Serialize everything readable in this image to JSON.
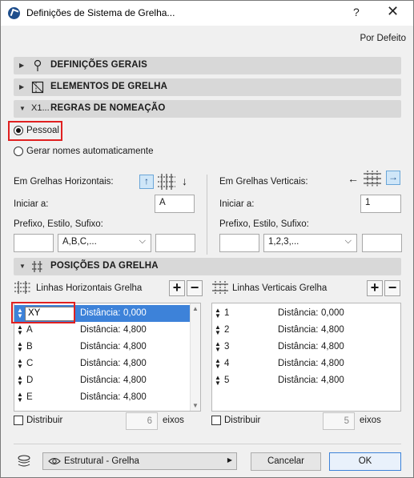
{
  "window": {
    "title": "Definições de Sistema de Grelha...",
    "help": "?",
    "close": "✕"
  },
  "header": {
    "default_link": "Por Defeito"
  },
  "sections": {
    "general": "DEFINIÇÕES GERAIS",
    "elements": "ELEMENTOS DE GRELHA",
    "naming": "REGRAS DE NOMEAÇÃO",
    "naming_icon_text": "X1...",
    "positions": "POSIÇÕES DA GRELHA"
  },
  "naming": {
    "personal": "Pessoal",
    "auto": "Gerar nomes automaticamente",
    "selected": "personal",
    "horizontal": {
      "title": "Em Grelhas Horizontais:",
      "start_label": "Iniciar a:",
      "start_value": "A",
      "prefix_label": "Prefixo, Estilo, Sufixo:",
      "prefix_value": "",
      "style_value": "A,B,C,...",
      "suffix_value": ""
    },
    "vertical": {
      "title": "Em Grelhas Verticais:",
      "start_label": "Iniciar a:",
      "start_value": "1",
      "prefix_label": "Prefixo, Estilo, Sufixo:",
      "prefix_value": "",
      "style_value": "1,2,3,...",
      "suffix_value": ""
    }
  },
  "positions": {
    "horizontal": {
      "title": "Linhas Horizontais Grelha",
      "rows": [
        {
          "name": "XY",
          "dist_label": "Distância:",
          "dist_value": "0,000",
          "selected": true
        },
        {
          "name": "A",
          "dist_label": "Distância:",
          "dist_value": "4,800"
        },
        {
          "name": "B",
          "dist_label": "Distância:",
          "dist_value": "4,800"
        },
        {
          "name": "C",
          "dist_label": "Distância:",
          "dist_value": "4,800"
        },
        {
          "name": "D",
          "dist_label": "Distância:",
          "dist_value": "4,800"
        },
        {
          "name": "E",
          "dist_label": "Distância:",
          "dist_value": "4,800"
        }
      ],
      "distribute_label": "Distribuir",
      "axes_count": "6",
      "axes_label": "eixos"
    },
    "vertical": {
      "title": "Linhas Verticais Grelha",
      "rows": [
        {
          "name": "1",
          "dist_label": "Distância:",
          "dist_value": "0,000"
        },
        {
          "name": "2",
          "dist_label": "Distância:",
          "dist_value": "4,800"
        },
        {
          "name": "3",
          "dist_label": "Distância:",
          "dist_value": "4,800"
        },
        {
          "name": "4",
          "dist_label": "Distância:",
          "dist_value": "4,800"
        },
        {
          "name": "5",
          "dist_label": "Distância:",
          "dist_value": "4,800"
        }
      ],
      "distribute_label": "Distribuir",
      "axes_count": "5",
      "axes_label": "eixos"
    },
    "add": "+",
    "remove": "−"
  },
  "footer": {
    "layer_value": "Estrutural - Grelha",
    "cancel": "Cancelar",
    "ok": "OK"
  },
  "colors": {
    "accent": "#3d82d9",
    "highlight_border": "#e02020",
    "section_bg": "#d8d8d8"
  }
}
